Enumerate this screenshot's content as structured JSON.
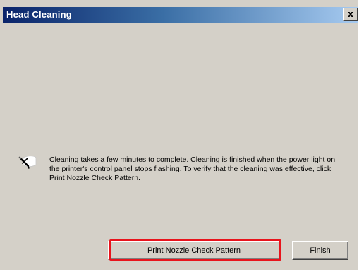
{
  "dialog": {
    "title": "Head Cleaning",
    "close_glyph": "x",
    "message_icon": "pencil-note-icon",
    "message": "Cleaning takes a few minutes to complete. Cleaning is finished when the power light on the printer's control panel stops flashing. To verify that the cleaning was effective, click Print Nozzle Check Pattern.",
    "buttons": {
      "nozzle_check": "Print Nozzle Check Pattern",
      "finish": "Finish"
    },
    "highlight_color": "#e8141d"
  }
}
